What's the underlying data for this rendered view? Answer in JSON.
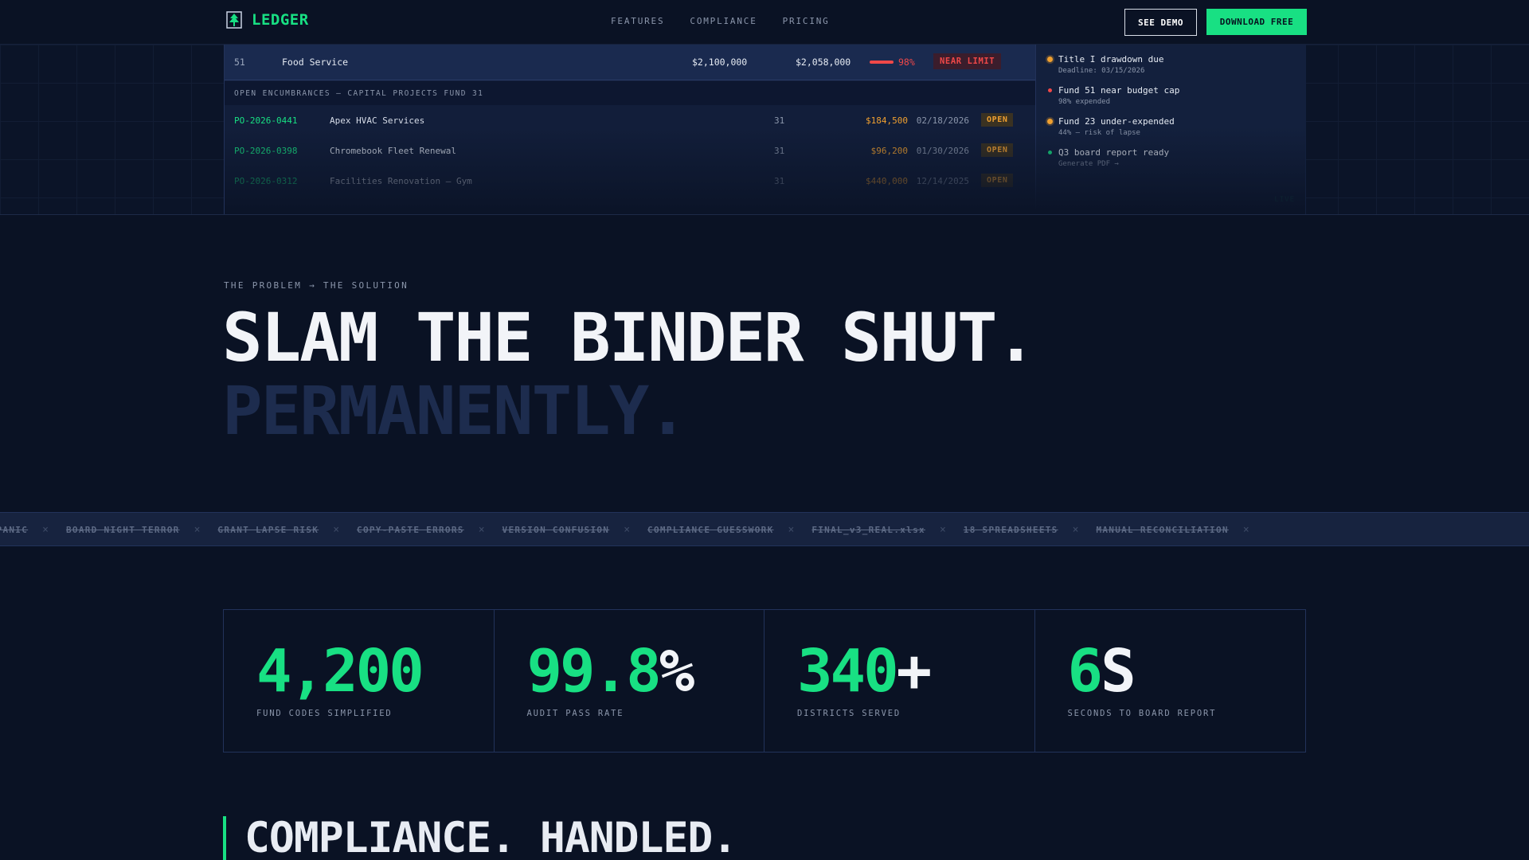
{
  "nav": {
    "logo_text": "LEDGER",
    "links": [
      "FEATURES",
      "COMPLIANCE",
      "PRICING"
    ],
    "demo_label": "SEE DEMO",
    "download_label": "DOWNLOAD FREE"
  },
  "dashboard": {
    "fund_row": {
      "code": "51",
      "name": "Food Service",
      "budget": "$2,100,000",
      "spent": "$2,058,000",
      "percent": "98%",
      "badge": "NEAR LIMIT"
    },
    "encumbrance_header": "OPEN ENCUMBRANCES — CAPITAL PROJECTS FUND 31",
    "encumbrances": [
      {
        "po": "PO-2026-0441",
        "vendor": "Apex HVAC Services",
        "fund": "31",
        "amount": "$184,500",
        "date": "02/18/2026",
        "status": "OPEN"
      },
      {
        "po": "PO-2026-0398",
        "vendor": "Chromebook Fleet Renewal",
        "fund": "31",
        "amount": "$96,200",
        "date": "01/30/2026",
        "status": "OPEN"
      },
      {
        "po": "PO-2026-0312",
        "vendor": "Facilities Renovation — Gym",
        "fund": "31",
        "amount": "$440,000",
        "date": "12/14/2025",
        "status": "OPEN"
      }
    ],
    "alerts": [
      {
        "title": "Title I drawdown due",
        "sub": "Deadline: 03/15/2026",
        "color": "#f0a030"
      },
      {
        "title": "Fund 51 near budget cap",
        "sub": "98% expended",
        "color": "#f04848"
      },
      {
        "title": "Fund 23 under-expended",
        "sub": "44% — risk of lapse",
        "color": "#f0a030"
      },
      {
        "title": "Q3 board report ready",
        "sub": "Generate PDF →",
        "color": "#18e083"
      }
    ],
    "live_label": "LIVE"
  },
  "problem": {
    "eyebrow": "THE PROBLEM → THE SOLUTION",
    "headline_1": "SLAM THE BINDER SHUT.",
    "headline_2": "PERMANENTLY."
  },
  "ticker": [
    "AUDIT PANIC",
    "BOARD NIGHT TERROR",
    "GRANT LAPSE RISK",
    "COPY-PASTE ERRORS",
    "VERSION CONFUSION",
    "COMPLIANCE GUESSWORK",
    "FINAL_v3_REAL.xlsx",
    "18 SPREADSHEETS",
    "MANUAL RECONCILIATION"
  ],
  "stats": [
    {
      "num": "4,200",
      "suffix": "",
      "label": "FUND CODES SIMPLIFIED"
    },
    {
      "num": "99.8",
      "suffix": "%",
      "label": "AUDIT PASS RATE"
    },
    {
      "num": "340",
      "suffix": "+",
      "label": "DISTRICTS SERVED"
    },
    {
      "num": "6",
      "suffix": "S",
      "label": "SECONDS TO BOARD REPORT"
    }
  ],
  "compliance": {
    "title": "COMPLIANCE. HANDLED."
  },
  "colors": {
    "accent": "#18e083",
    "warning": "#f0a030",
    "danger": "#f04848",
    "background": "#0a1224"
  }
}
